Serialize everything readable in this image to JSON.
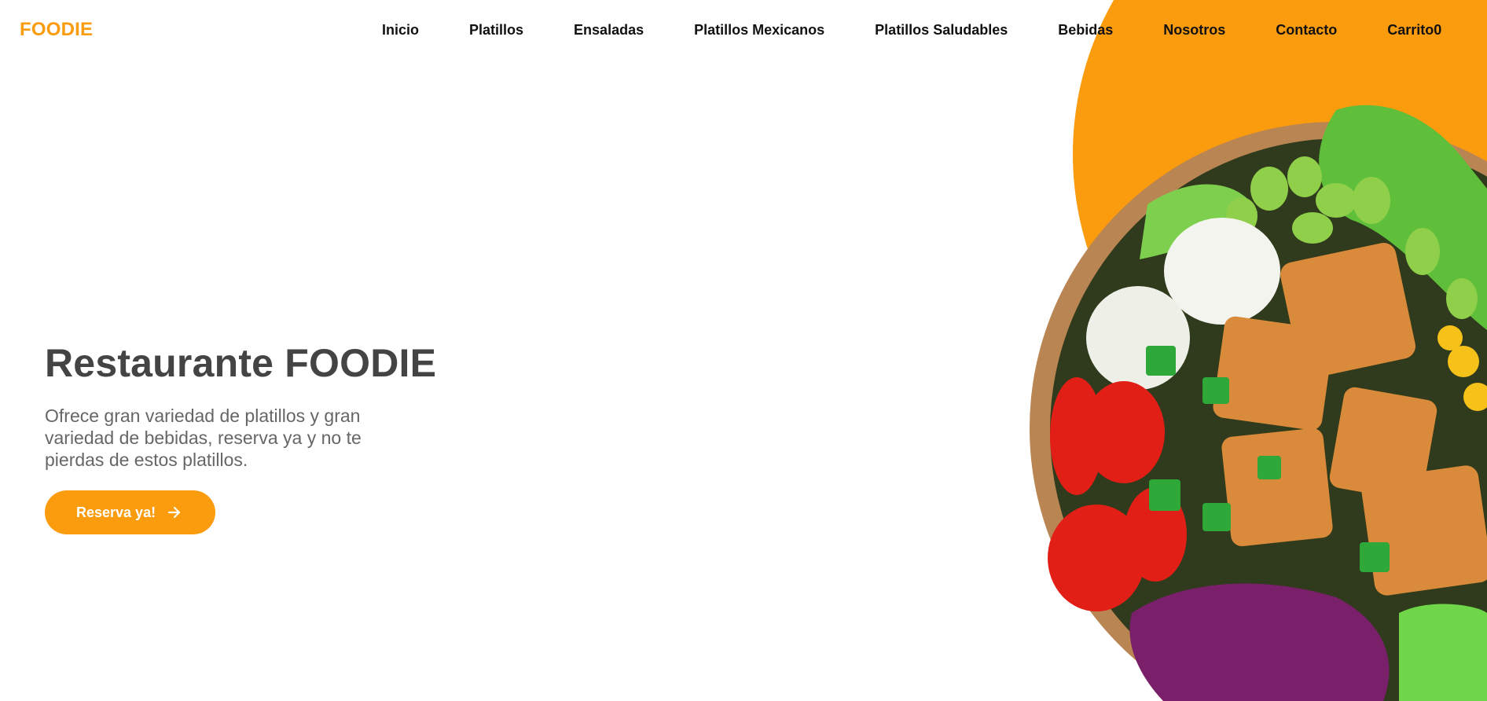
{
  "brand": {
    "name": "FOODIE",
    "color": "#fb9b0e"
  },
  "nav": {
    "items": [
      {
        "label": "Inicio"
      },
      {
        "label": "Platillos"
      },
      {
        "label": "Ensaladas"
      },
      {
        "label": "Platillos Mexicanos"
      },
      {
        "label": "Platillos Saludables"
      },
      {
        "label": "Bebidas"
      },
      {
        "label": "Nosotros"
      },
      {
        "label": "Contacto"
      },
      {
        "label": "Carrito0"
      }
    ]
  },
  "hero": {
    "title": "Restaurante FOODIE",
    "description": "Ofrece gran variedad de platillos y gran variedad de bebidas, reserva ya y no te pierdas de estos platillos.",
    "cta_label": "Reserva ya!",
    "cta_icon": "arrow-right-icon"
  },
  "image": {
    "subject": "salad-bowl-image",
    "backdrop_color": "#fb9b0e"
  }
}
